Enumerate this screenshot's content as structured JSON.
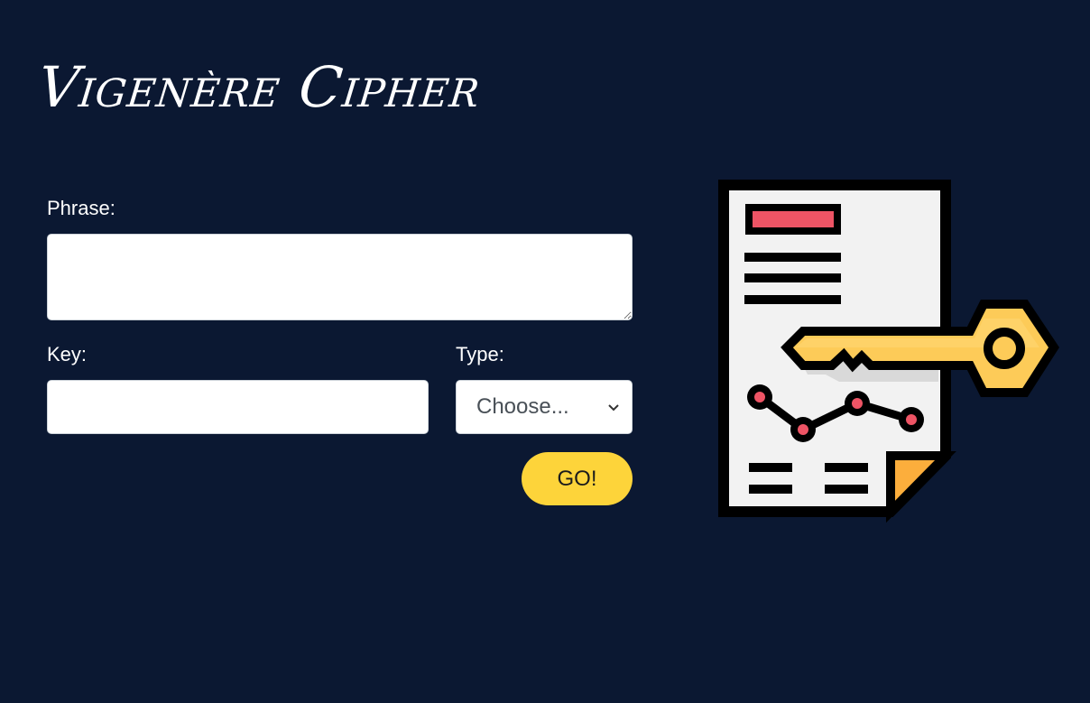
{
  "header": {
    "title": "Vigenère Cipher"
  },
  "form": {
    "phrase": {
      "label": "Phrase:",
      "value": "",
      "placeholder": ""
    },
    "key": {
      "label": "Key:",
      "value": "",
      "placeholder": ""
    },
    "type": {
      "label": "Type:",
      "selected": "Choose..."
    },
    "submit_label": "GO!"
  },
  "illustration": {
    "icon": "document-key-icon",
    "colors": {
      "background": "#0b1832",
      "paper": "#f2f2f2",
      "outline": "#000000",
      "red": "#ee5465",
      "key": "#fdcb58",
      "fold": "#fcae3c",
      "button": "#fdd43a"
    }
  }
}
